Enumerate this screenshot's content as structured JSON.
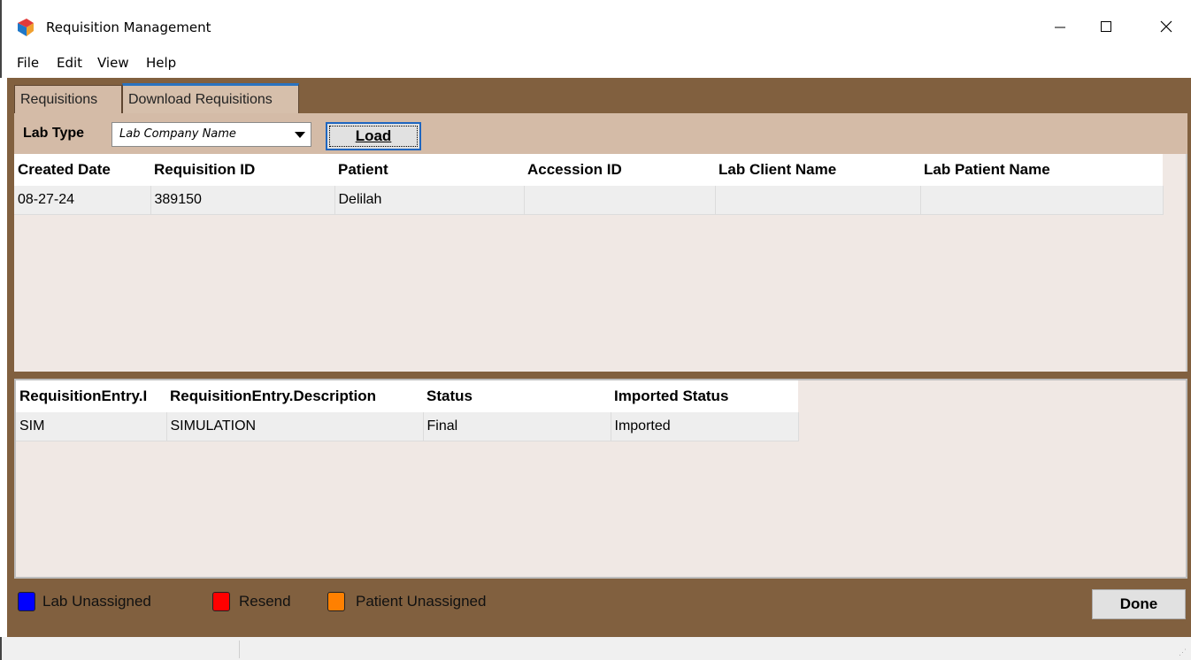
{
  "window": {
    "title": "Requisition Management",
    "icon": "app-logo-icon",
    "controls": [
      "minimize-icon",
      "maximize-icon",
      "close-icon"
    ]
  },
  "menu": {
    "file": "File",
    "edit": "Edit",
    "view": "View",
    "help": "Help"
  },
  "tabs": {
    "requisitions": "Requisitions",
    "download": "Download Requisitions",
    "active": "Download Requisitions"
  },
  "toolbar": {
    "lab_type_label": "Lab Type",
    "lab_type_value": "Lab Company Name",
    "load_label": "Load"
  },
  "requisitions_grid": {
    "columns": [
      "Created Date",
      "Requisition ID",
      "Patient",
      "Accession ID",
      "Lab Client Name",
      "Lab Patient Name"
    ],
    "rows": [
      [
        "08-27-24",
        "389150",
        "Delilah",
        "",
        "",
        ""
      ]
    ]
  },
  "entries_grid": {
    "columns": [
      "RequisitionEntry.I",
      "RequisitionEntry.Description",
      "Status",
      "Imported Status"
    ],
    "rows": [
      [
        "SIM",
        "SIMULATION",
        "Final",
        "Imported"
      ]
    ]
  },
  "legend": {
    "lab_unassigned": "Lab Unassigned",
    "resend": "Resend",
    "patient_unassigned": "Patient Unassigned",
    "colors": {
      "lab_unassigned": "#0000ff",
      "resend": "#ff0000",
      "patient_unassigned": "#ff8000"
    }
  },
  "actions": {
    "done_label": "Done"
  },
  "colors": {
    "frame_brown": "#81603f",
    "panel_tan": "#d4bba7",
    "grid_bg": "#f0e8e4"
  }
}
